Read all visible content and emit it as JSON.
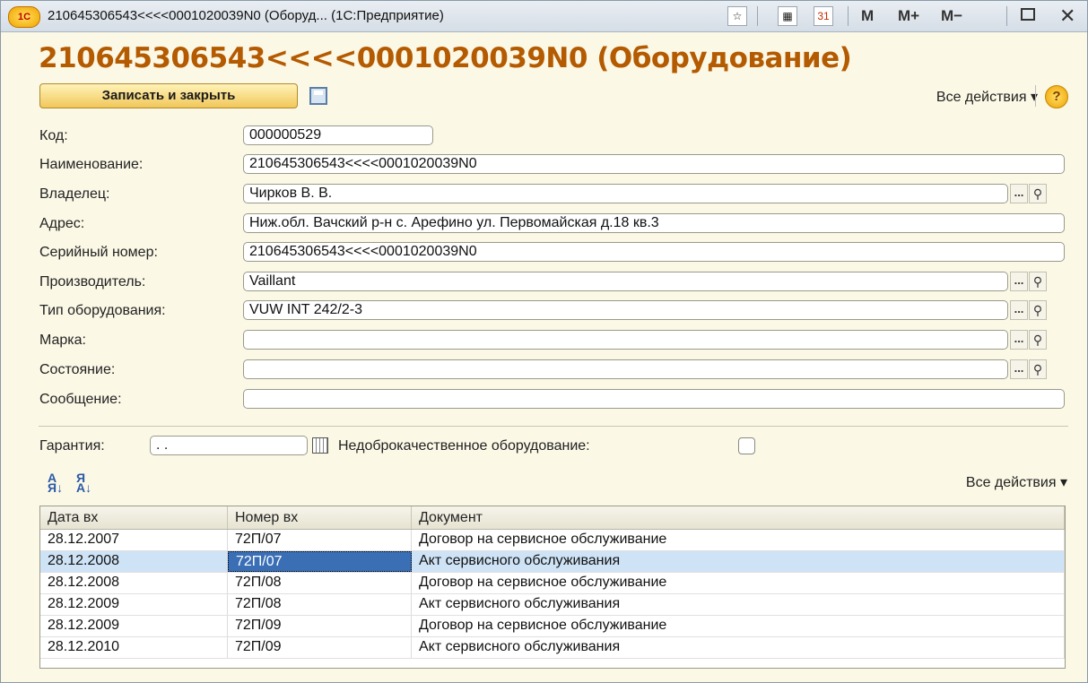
{
  "window": {
    "title": "210645306543<<<<0001020039N0 (Оборуд...  (1С:Предприятие)",
    "logo_text": "1С",
    "toolbar_buttons": {
      "m": "M",
      "m_plus": "M+",
      "m_minus": "M−"
    }
  },
  "form": {
    "title": "210645306543<<<<0001020039N0 (Оборудование)",
    "save_close_label": "Записать и закрыть",
    "all_actions_label": "Все действия ▾",
    "help_label": "?"
  },
  "fields": {
    "code": {
      "label": "Код:",
      "value": "000000529"
    },
    "name": {
      "label": "Наименование:",
      "value": "210645306543<<<<0001020039N0"
    },
    "owner": {
      "label": "Владелец:",
      "value": "Чирков В. В."
    },
    "address": {
      "label": "Адрес:",
      "value": "Ниж.обл. Вачский р-н с. Арефино ул. Первомайская д.18 кв.3"
    },
    "serial": {
      "label": "Серийный номер:",
      "value": "210645306543<<<<0001020039N0"
    },
    "manufacturer": {
      "label": "Производитель:",
      "value": "Vaillant"
    },
    "equipment_type": {
      "label": "Тип оборудования:",
      "value": "VUW INT 242/2-3"
    },
    "brand": {
      "label": "Марка:",
      "value": ""
    },
    "state": {
      "label": "Состояние:",
      "value": ""
    },
    "message": {
      "label": "Сообщение:",
      "value": ""
    }
  },
  "warranty": {
    "label": "Гарантия:",
    "value": " .  ."
  },
  "defective": {
    "label": "Недоброкачественное оборудование:",
    "checked": false
  },
  "table_toolbar": {
    "all_actions_label": "Все действия ▾"
  },
  "table": {
    "headers": [
      "Дата вх",
      "Номер вх",
      "Документ"
    ],
    "rows": [
      [
        "28.12.2007",
        "72П/07",
        "Договор на сервисное обслуживание"
      ],
      [
        "28.12.2008",
        "72П/07",
        "Акт сервисного обслуживания"
      ],
      [
        "28.12.2008",
        "72П/08",
        "Договор на сервисное обслуживание"
      ],
      [
        "28.12.2009",
        "72П/08",
        "Акт сервисного обслуживания"
      ],
      [
        "28.12.2009",
        "72П/09",
        "Договор на сервисное обслуживание"
      ],
      [
        "28.12.2010",
        "72П/09",
        "Акт сервисного обслуживания"
      ]
    ],
    "selected_row": 1
  }
}
